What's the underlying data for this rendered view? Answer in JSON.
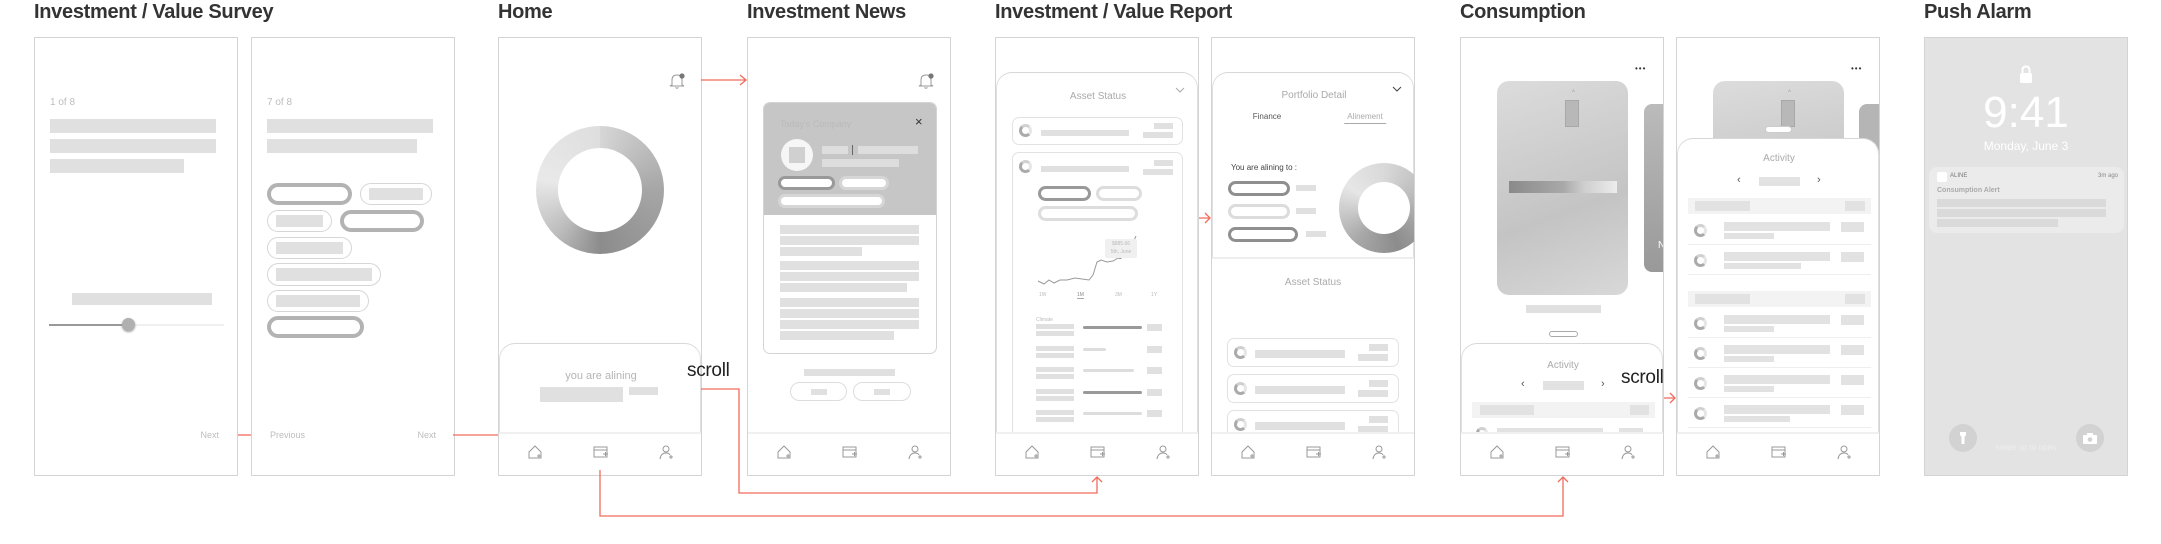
{
  "titles": {
    "survey": "Investment / Value Survey",
    "home": "Home",
    "news": "Investment News",
    "report": "Investment / Value Report",
    "consumption": "Consumption",
    "push": "Push Alarm"
  },
  "flow_labels": {
    "scroll_home": "scroll",
    "scroll_consumption": "scroll"
  },
  "survey1": {
    "progress": "1 of 8",
    "next": "Next",
    "slider_value": 0.45
  },
  "survey2": {
    "progress": "7 of 8",
    "previous": "Previous",
    "next": "Next"
  },
  "home": {
    "aligning_label": "you are alining"
  },
  "news": {
    "card_title": "Today's Company",
    "close": "×"
  },
  "report1": {
    "title": "Asset Status",
    "tooltip_value": "$885.66",
    "tooltip_date": "5th, June",
    "ranges": [
      "1W",
      "1M",
      "3M",
      "1Y"
    ],
    "selected_range": "1M",
    "category": "Climate"
  },
  "report2": {
    "title": "Portfolio Detail",
    "tabs": [
      "Finance",
      "Alinement"
    ],
    "active_tab": "Alinement",
    "aligning_to": "You are alining to :",
    "asset_title": "Asset Status"
  },
  "consumption1": {
    "more": "•••",
    "side_card_letter": "N",
    "activity": "Activity",
    "prev": "‹",
    "next": "›"
  },
  "consumption2": {
    "more": "•••",
    "activity": "Activity",
    "prev": "‹",
    "next": "›"
  },
  "push": {
    "time": "9:41",
    "date": "Monday, June 3",
    "app": "ALINE",
    "ago": "3m ago",
    "alert_title": "Consumption Alert",
    "swipe": "swipe up to open"
  },
  "colors": {
    "flow": "#f26b5b",
    "wire": "#e0e0e0",
    "frame": "#d4d4d4"
  }
}
